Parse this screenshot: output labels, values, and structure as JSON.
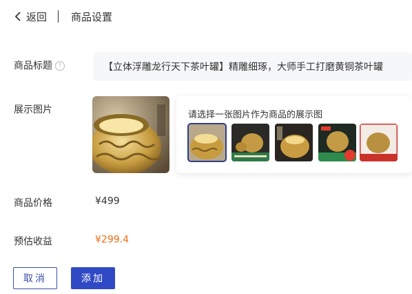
{
  "header": {
    "back_label": "返回",
    "title": "商品设置"
  },
  "form": {
    "title_label": "商品标题",
    "help_glyph": "?",
    "title_value": "【立体浮雕龙行天下茶叶罐】精雕细琢，大师手工打磨黄铜茶叶罐",
    "images_label": "展示图片",
    "picker_title": "请选择一张图片作为商品的展示图",
    "price_label": "商品价格",
    "price_value": "¥499",
    "earnings_label": "预估收益",
    "earnings_value": "¥299.4"
  },
  "thumbnails": [
    {
      "name": "brass-pot-open",
      "selected": true
    },
    {
      "name": "brass-pot-set-green-banner",
      "selected": false
    },
    {
      "name": "brass-pot-dark",
      "selected": false
    },
    {
      "name": "brass-pot-green-price-badge",
      "selected": false
    },
    {
      "name": "brass-pot-red-promo",
      "selected": false
    }
  ],
  "buttons": {
    "cancel_label": "取消",
    "add_label": "添加"
  },
  "colors": {
    "accent": "#3049c4",
    "earnings": "#f06c16",
    "title_bg": "#f6f7f9"
  }
}
